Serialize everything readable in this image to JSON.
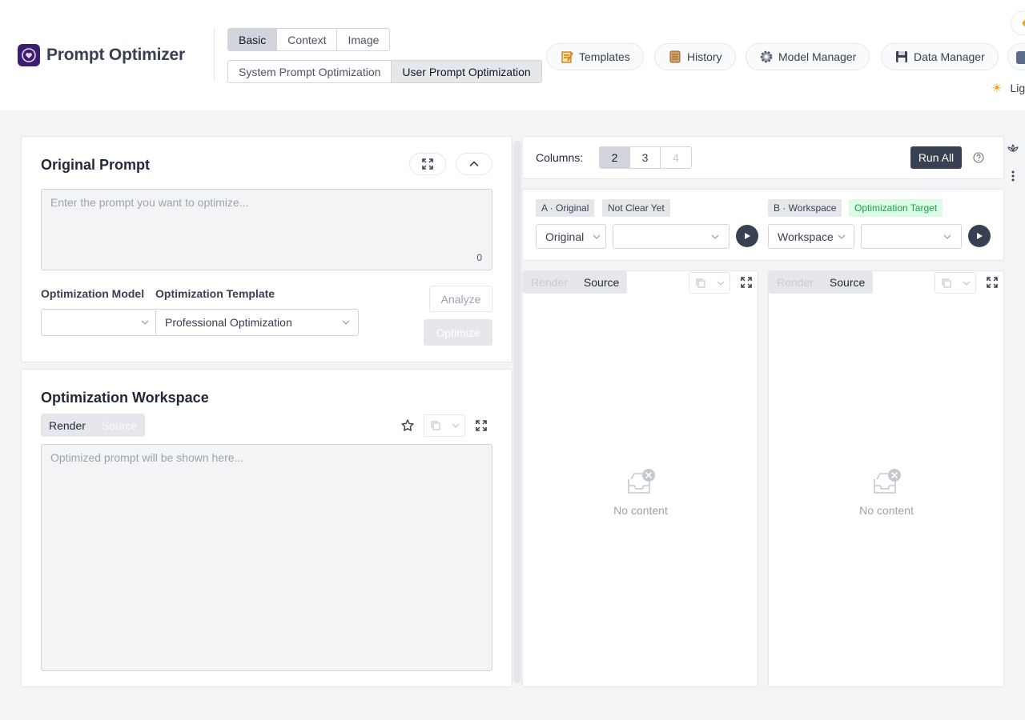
{
  "header": {
    "app_title": "Prompt Optimizer",
    "mode_tabs": [
      "Basic",
      "Context",
      "Image"
    ],
    "type_tabs": [
      "System Prompt Optimization",
      "User Prompt Optimization"
    ],
    "nav": {
      "templates": "Templates",
      "history": "History",
      "model_manager": "Model Manager",
      "data_manager": "Data Manager"
    },
    "theme_label": "Lig"
  },
  "original": {
    "title": "Original Prompt",
    "placeholder": "Enter the prompt you want to optimize...",
    "char_count": "0",
    "model_label": "Optimization Model",
    "model_value": "",
    "template_label": "Optimization Template",
    "template_value": "Professional Optimization",
    "analyze_label": "Analyze",
    "optimize_label": "Optimize"
  },
  "workspace": {
    "title": "Optimization Workspace",
    "tab_render": "Render",
    "tab_source": "Source",
    "placeholder": "Optimized prompt will be shown here..."
  },
  "compare": {
    "columns_label": "Columns:",
    "column_options": [
      "2",
      "3",
      "4"
    ],
    "run_all_label": "Run All",
    "col_a": {
      "tag": "A · Original",
      "status": "Not Clear Yet",
      "source_value": "Original",
      "model_value": ""
    },
    "col_b": {
      "tag": "B · Workspace",
      "status": "Optimization Target",
      "source_value": "Workspace",
      "model_value": ""
    },
    "tab_render": "Render",
    "tab_source": "Source",
    "empty_text": "No content"
  }
}
